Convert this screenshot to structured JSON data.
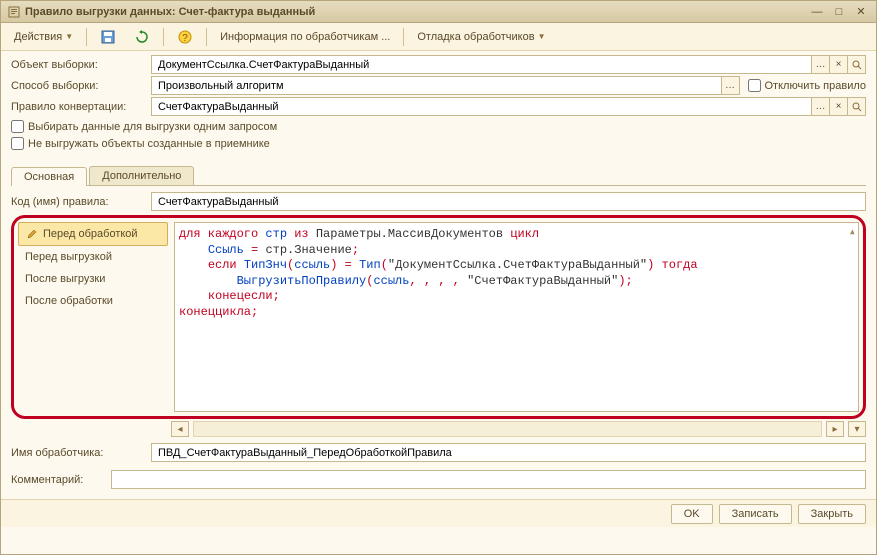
{
  "window": {
    "title": "Правило выгрузки данных: Счет-фактура выданный"
  },
  "toolbar": {
    "actions": "Действия",
    "info_handlers": "Информация по обработчикам ...",
    "debug_handlers": "Отладка обработчиков"
  },
  "fields": {
    "object_label": "Объект выборки:",
    "object_value": "ДокументСсылка.СчетФактураВыданный",
    "method_label": "Способ выборки:",
    "method_value": "Произвольный алгоритм",
    "disable_rule": "Отключить правило",
    "conv_rule_label": "Правило конвертации:",
    "conv_rule_value": "СчетФактураВыданный",
    "single_query": "Выбирать данные для выгрузки одним запросом",
    "skip_receiver": "Не выгружать объекты созданные в приемнике"
  },
  "tabs": {
    "main": "Основная",
    "extra": "Дополнительно"
  },
  "rule": {
    "code_label": "Код (имя) правила:",
    "code_value": "СчетФактураВыданный"
  },
  "handlers": {
    "before_process": "Перед обработкой",
    "before_export": "Перед выгрузкой",
    "after_export": "После выгрузки",
    "after_process": "После обработки"
  },
  "code": {
    "kw_for": "для каждого",
    "var_str": "стр",
    "kw_from": "из",
    "param_array": "Параметры.МассивДокументов",
    "kw_loop": "цикл",
    "line2_l": "Ссыль",
    "line2_r": "стр.Значение",
    "kw_if": "если",
    "fn_type": "ТипЗнч",
    "arg_ref": "ссыль",
    "fn_type2": "Тип",
    "type_str": "\"ДокументСсылка.СчетФактураВыданный\"",
    "kw_then": "тогда",
    "fn_export": "ВыгрузитьПоПравилу",
    "rule_str": "\"СчетФактураВыданный\"",
    "kw_endif": "конецесли",
    "kw_endloop": "конеццикла"
  },
  "handler_name": {
    "label": "Имя обработчика:",
    "value": "ПВД_СчетФактураВыданный_ПередОбработкойПравила"
  },
  "comment": {
    "label": "Комментарий:",
    "value": ""
  },
  "footer": {
    "ok": "OK",
    "save": "Записать",
    "close": "Закрыть"
  }
}
